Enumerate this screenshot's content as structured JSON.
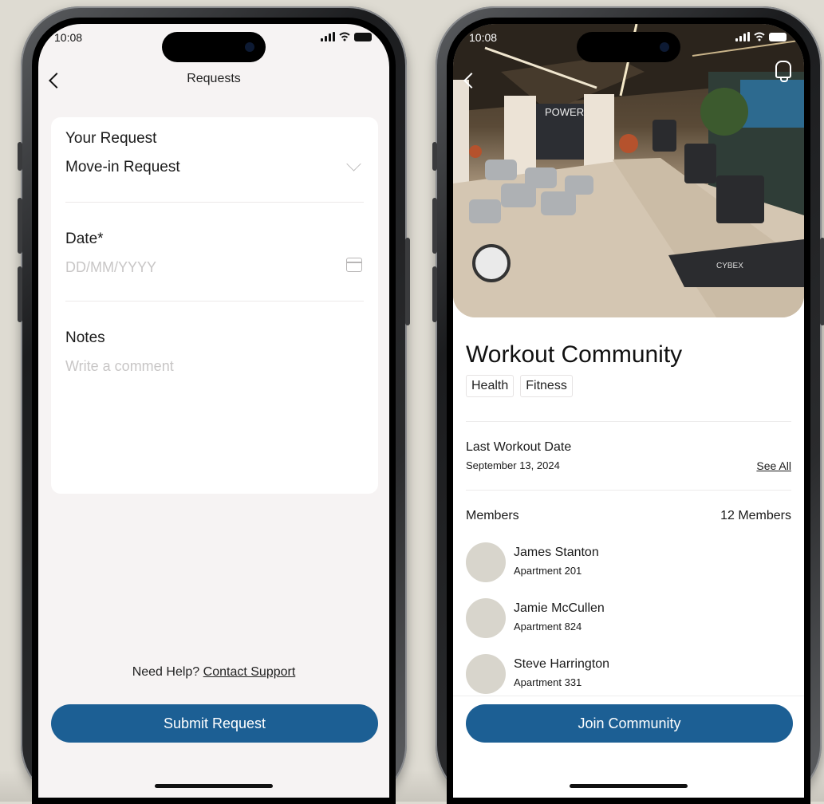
{
  "left_phone": {
    "status_time": "10:08",
    "header_title": "Requests",
    "form": {
      "request_label": "Your Request",
      "request_value": "Move-in Request",
      "date_label": "Date*",
      "date_placeholder": "DD/MM/YYYY",
      "notes_label": "Notes",
      "notes_placeholder": "Write a comment"
    },
    "help_text": "Need Help?",
    "help_link": "Contact Support",
    "submit_label": "Submit Request"
  },
  "right_phone": {
    "status_time": "10:08",
    "title": "Workout Community",
    "tags": [
      "Health",
      "Fitness"
    ],
    "last_workout_label": "Last Workout Date",
    "last_workout_date": "September 13, 2024",
    "see_all_label": "See All",
    "members_label": "Members",
    "members_count": "12 Members",
    "members": [
      {
        "name": "James Stanton",
        "apartment": "Apartment 201"
      },
      {
        "name": "Jamie McCullen",
        "apartment": "Apartment 824"
      },
      {
        "name": "Steve Harrington",
        "apartment": "Apartment 331"
      }
    ],
    "join_label": "Join Community",
    "hero_sign_text": "POWER",
    "hero_machine_text": "CYBEX"
  },
  "colors": {
    "primary": "#1c5f94",
    "background": "#dedbd2",
    "avatar": "#d8d5cc"
  }
}
